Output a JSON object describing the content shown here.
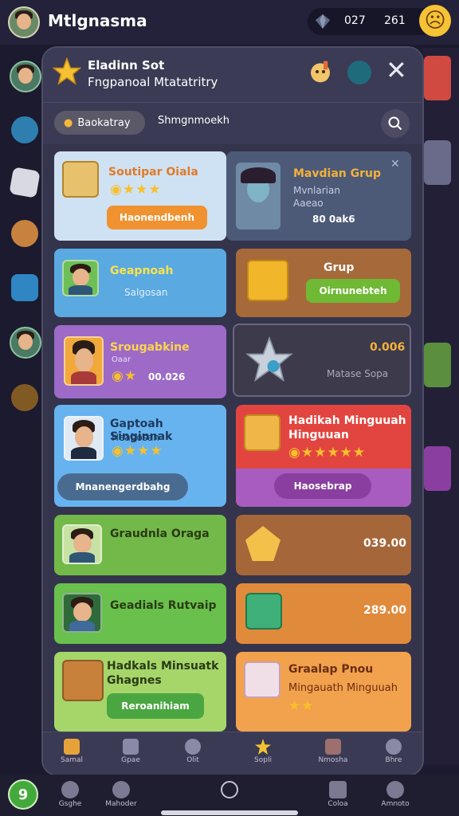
{
  "header": {
    "app_title": "Mtlgnasma",
    "currency_a": "027",
    "currency_b": "261"
  },
  "modal": {
    "title": "Eladinn Sot",
    "subtitle": "Fngpanoal Mtatatritry",
    "tabs": [
      {
        "label": "Baokatray"
      },
      {
        "label": "Shmgnmoekh"
      }
    ]
  },
  "cards": [
    {
      "title": "Soutipar Oiala",
      "button": "Haonendbenh",
      "color": "#cfe2f3"
    },
    {
      "title": "Mavdian Grup",
      "sub1": "Mvnlarian",
      "sub2": "Aaeao",
      "value": "80 0ak6",
      "color": "#4c5a78"
    },
    {
      "title": "Geapnoah",
      "sub": "Salgosan",
      "color": "#5aa9e0"
    },
    {
      "title": "Grup",
      "button": "Oirnunebteh",
      "color": "#a66a3a"
    },
    {
      "title": "Srougabkine",
      "sub": "Oaar",
      "value": "00.026",
      "color": "#9d6ac8"
    },
    {
      "value": "0.006",
      "sub": "Matase Sopa",
      "color": "#3d3a4c"
    },
    {
      "title": "Gaptoah Singinnak",
      "sub": "Heabosan",
      "button": "Mnanengerdbahg",
      "color": "#67b3ef"
    },
    {
      "title": "Hadikah Minguuah",
      "title2": "Hinguuan",
      "button": "Haosebrap",
      "color": "#e2453f"
    },
    {
      "title": "Graudnla Oraga",
      "color": "#73b94a"
    },
    {
      "value": "039.00",
      "color": "#a5673a"
    },
    {
      "title": "Geadials Rutvaip",
      "color": "#69c04c"
    },
    {
      "value": "289.00",
      "color": "#e08a3c"
    },
    {
      "title": "Hadkals Minsuatk",
      "title2": "Ghagnes",
      "button": "Reroanihiam",
      "color": "#a6d66a"
    },
    {
      "title": "Graalap Pnou",
      "sub": "Mingauath Minguuah",
      "color": "#f2a14d"
    }
  ],
  "nav": [
    {
      "label": "Samal",
      "color": "#e7a33a"
    },
    {
      "label": "Gpae",
      "color": "#8a8aa6"
    },
    {
      "label": "Olit",
      "color": "#8a8aa6"
    },
    {
      "label": "Sopli",
      "color": "#f2c232"
    },
    {
      "label": "Nmosha",
      "color": "#9d6f6f"
    },
    {
      "label": "Bhre",
      "color": "#8a8aa6"
    }
  ],
  "bottom": [
    {
      "label": "Gsghe"
    },
    {
      "label": "Mahoder"
    },
    {
      "label": "Coloa"
    },
    {
      "label": "Amnoto"
    }
  ],
  "map_button": "9"
}
